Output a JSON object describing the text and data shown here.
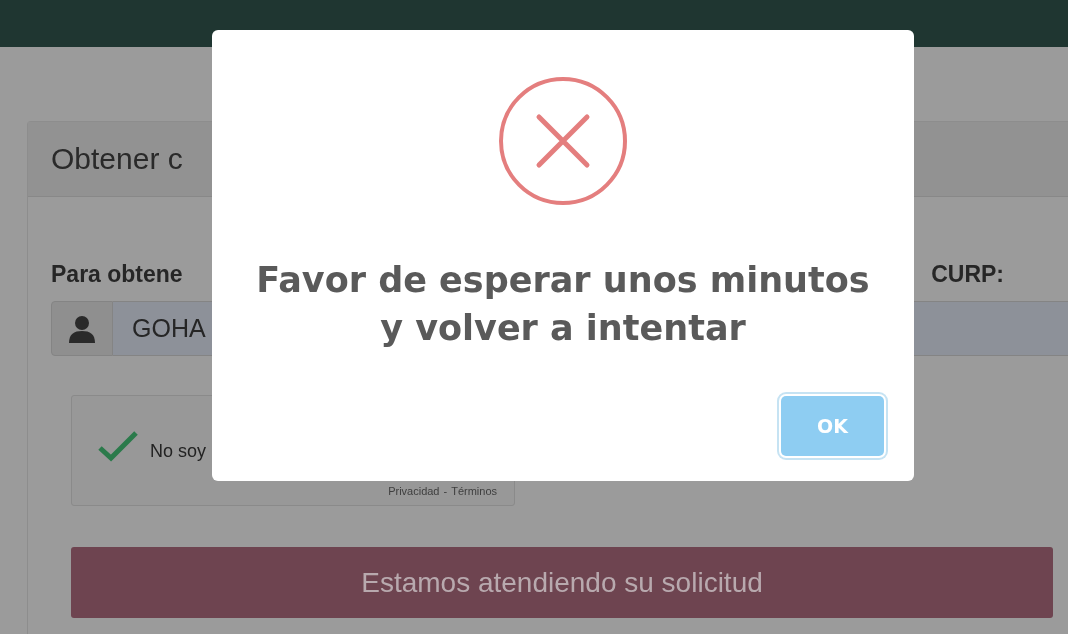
{
  "panel": {
    "title": "Obtener c"
  },
  "form": {
    "label_start": "Para obtene",
    "label_end": "CURP:",
    "curp_value": "GOHA"
  },
  "captcha": {
    "checked": true,
    "label": "No soy",
    "links": [
      {
        "label": "Privacidad"
      },
      {
        "label": "Términos"
      }
    ],
    "separator": "-"
  },
  "submit_button": {
    "label": "Estamos atendiendo su solicitud",
    "disabled": true
  },
  "dialog": {
    "message": "Favor de esperar unos minutos y volver a intentar",
    "buttons": [
      {
        "label": "OK",
        "focused": true
      }
    ]
  }
}
